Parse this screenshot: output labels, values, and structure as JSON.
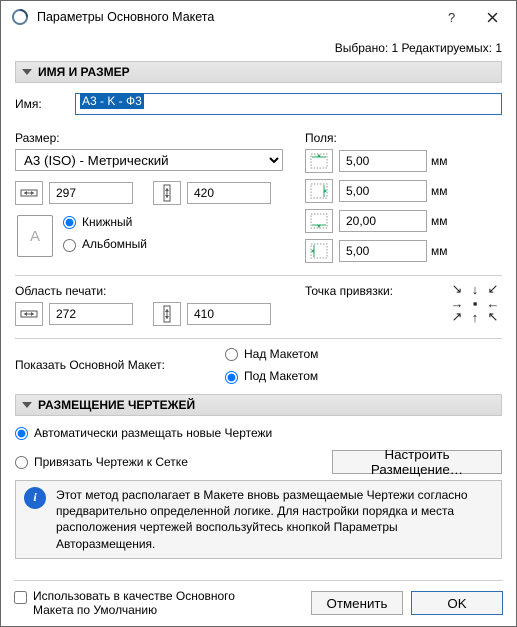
{
  "window": {
    "title": "Параметры Основного Макета"
  },
  "status": "Выбрано: 1 Редактируемых: 1",
  "section1": {
    "header": "ИМЯ И РАЗМЕР",
    "name_label": "Имя:",
    "name_value": "A3 - K - Ф3",
    "size_label": "Размер:",
    "size_preset": "A3 (ISO) - Метрический",
    "width_value": "297",
    "height_value": "420",
    "portrait_label": "Книжный",
    "landscape_label": "Альбомный",
    "margins_label": "Поля:",
    "margin_top": "5,00",
    "margin_right": "5,00",
    "margin_bottom": "20,00",
    "margin_left": "5,00",
    "unit": "мм",
    "print_area_label": "Область печати:",
    "print_w": "272",
    "print_h": "410",
    "anchor_label": "Точка привязки:",
    "show_master_label": "Показать Основной Макет:",
    "over_layout": "Над Макетом",
    "under_layout": "Под Макетом"
  },
  "section2": {
    "header": "РАЗМЕЩЕНИЕ ЧЕРТЕЖЕЙ",
    "auto_label": "Автоматически размещать новые Чертежи",
    "grid_label": "Привязать Чертежи к Сетке",
    "config_btn": "Настроить Размещение…",
    "info_text": "Этот метод располагает в Макете вновь размещаемые Чертежи согласно предварительно определенной логике. Для настройки порядка и места расположения чертежей воспользуйтесь кнопкой Параметры Авторазмещения."
  },
  "footer": {
    "use_default_label": "Использовать в качестве Основного Макета по Умолчанию",
    "cancel": "Отменить",
    "ok": "OK"
  }
}
